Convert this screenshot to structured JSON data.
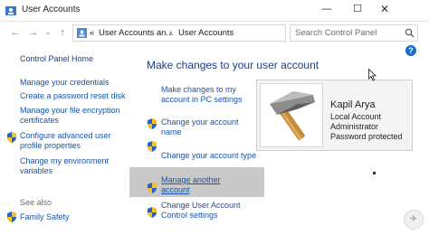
{
  "window": {
    "title": "User Accounts",
    "controls": {
      "minimize": "—",
      "maximize": "☐",
      "close": "✕"
    }
  },
  "address": {
    "overflow": "«",
    "crumbs": [
      "User Accounts an...",
      "User Accounts"
    ],
    "separator": "›"
  },
  "search": {
    "placeholder": "Search Control Panel"
  },
  "help": {
    "label": "?"
  },
  "left_pane": {
    "home": "Control Panel Home",
    "items": [
      "Manage your credentials",
      "Create a password reset disk",
      "Manage your file encryption",
      "certificates",
      "Configure advanced user",
      "profile properties",
      "Change my environment",
      "variables"
    ],
    "see_also": "See also",
    "family_safety": "Family Safety"
  },
  "main": {
    "heading": "Make changes to your user account",
    "links": {
      "pc_settings_1": "Make changes to my",
      "pc_settings_2": "account in PC settings",
      "name_1": "Change your account",
      "name_2": "name",
      "type": "Change your account type",
      "another_1": "Manage another",
      "another_2": "account",
      "uac_1": "Change User Account",
      "uac_2": "Control settings"
    }
  },
  "user": {
    "name": "Kapil Arya",
    "lines": [
      "Local Account",
      "Administrator",
      "Password protected"
    ]
  },
  "brand": {
    "mark": "✈"
  },
  "colors": {
    "link": "#1a54a8",
    "heading": "#1b3f87",
    "hover": "#c9c9c9"
  }
}
